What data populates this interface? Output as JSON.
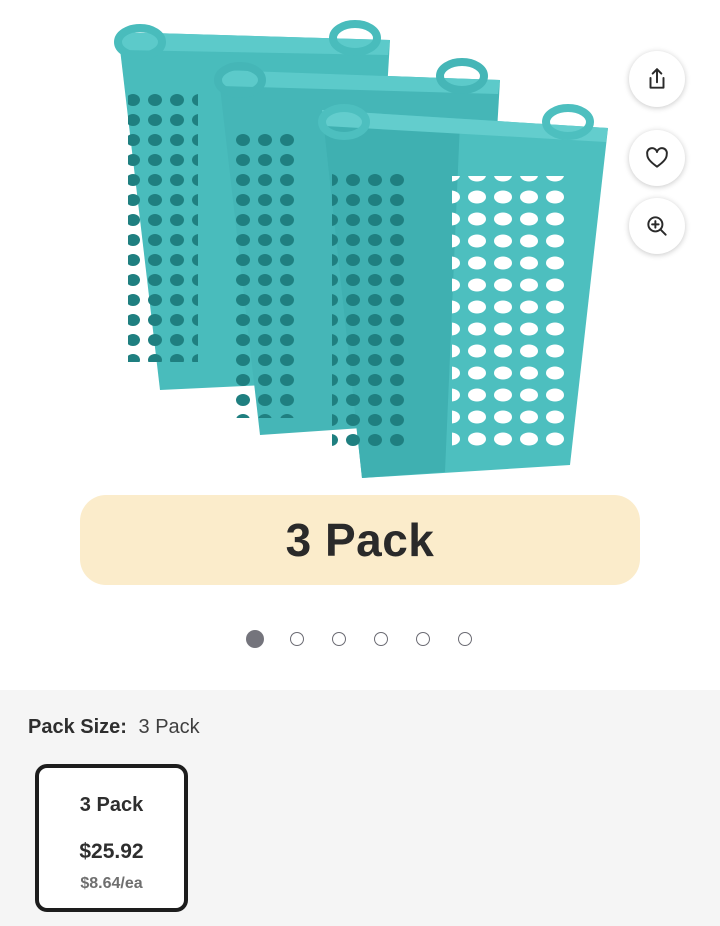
{
  "colors": {
    "basket": "#49bcbc",
    "basket_shadow": "#2e9a9b",
    "banner_bg": "#fbeccb",
    "selected_border": "#1d1d1d"
  },
  "hero": {
    "image_icon": "laundry-basket-3-pack",
    "banner_text": "3 Pack",
    "actions": [
      {
        "icon": "share-icon"
      },
      {
        "icon": "heart-icon"
      },
      {
        "icon": "zoom-in-icon"
      }
    ],
    "carousel": {
      "count": 6,
      "active": 0
    }
  },
  "options": {
    "pack_size_label": "Pack Size:",
    "pack_size_value": "3 Pack",
    "variants": [
      {
        "name": "3 Pack",
        "price": "$25.92",
        "unit_price": "$8.64/ea",
        "selected": true
      }
    ]
  }
}
